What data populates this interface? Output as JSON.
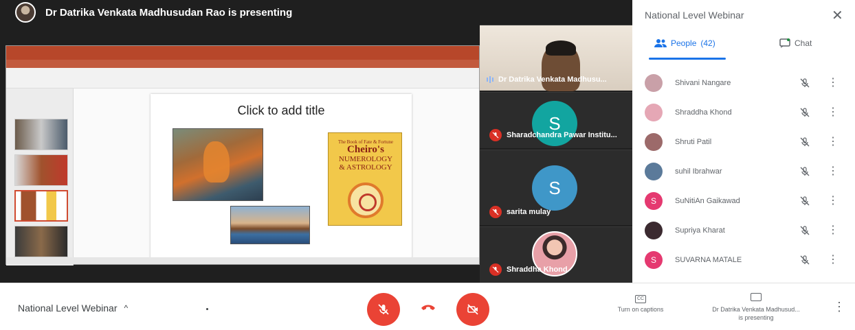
{
  "presenter_banner": {
    "text": "Dr Datrika Venkata Madhusudan Rao is presenting"
  },
  "slide": {
    "title": "Click to add title",
    "book_line1": "The Book of Fate & Fortune",
    "book_line2": "Cheiro's",
    "book_line3": "NUMEROLOGY",
    "book_line4": "& ASTROLOGY"
  },
  "tiles": [
    {
      "name": "Dr Datrika Venkata Madhusu..."
    },
    {
      "name": "Sharadchandra Pawar Institu...",
      "initial": "S"
    },
    {
      "name": "sarita mulay",
      "initial": "S"
    },
    {
      "name": "Shraddha Khond"
    }
  ],
  "panel": {
    "title": "National Level Webinar",
    "close_icon": "✕",
    "people_tab": "People",
    "people_count": "(42)",
    "chat_tab": "Chat",
    "people": [
      {
        "name": "Shivani Nangare",
        "initial": "",
        "avatar_color": "#c9a0a8"
      },
      {
        "name": "Shraddha Khond",
        "initial": "",
        "avatar_color": "#e5a7b5"
      },
      {
        "name": "Shruti Patil",
        "initial": "",
        "avatar_color": "#9c6a6a"
      },
      {
        "name": "suhil Ibrahwar",
        "initial": "",
        "avatar_color": "#5b7a9a"
      },
      {
        "name": "SuNitiAn Gaikawad",
        "initial": "S",
        "avatar_color": "#e53970"
      },
      {
        "name": "Supriya Kharat",
        "initial": "",
        "avatar_color": "#3b2a30"
      },
      {
        "name": "SUVARNA MATALE",
        "initial": "S",
        "avatar_color": "#e53970"
      }
    ]
  },
  "bottom": {
    "meeting_name": "National Level Webinar",
    "caret": "^",
    "captions_label": "Turn on captions",
    "captions_icon_text": "CC",
    "presenting_line1": "Dr Datrika Venkata Madhusud...",
    "presenting_line2": "is presenting",
    "more": "⋮"
  },
  "colors": {
    "accent": "#1a73e8",
    "danger": "#ea4335",
    "stage": "#1f1f1f"
  }
}
